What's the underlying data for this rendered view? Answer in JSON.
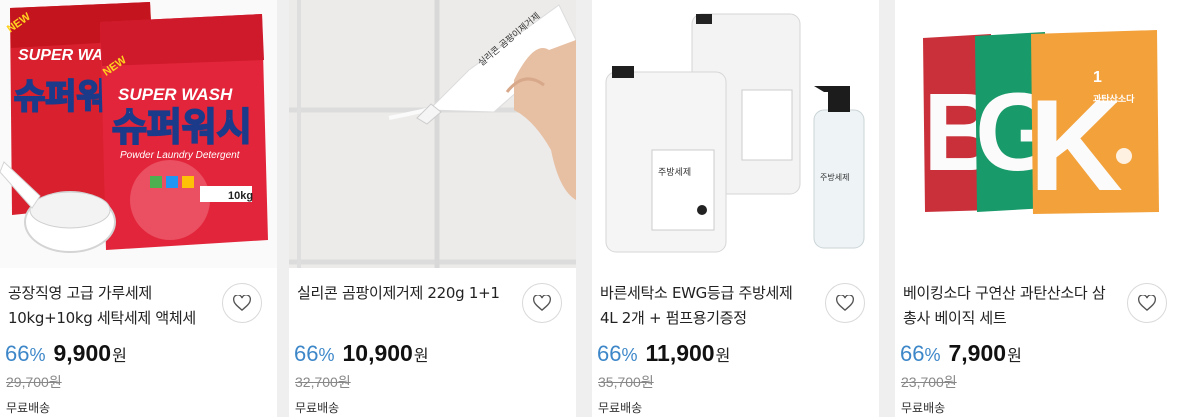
{
  "products": [
    {
      "title": "공장직영 고급 가루세제 10kg+10kg 세탁세제 액체세",
      "discount": "66",
      "price": "9,900",
      "currency": "원",
      "original_price": "29,700원",
      "shipping": "무료배송",
      "image_text": {
        "brand": "SUPER WASH",
        "name": "슈퍼워시",
        "sub": "Powder Laundry Detergent",
        "weight": "10kg",
        "badge": "NEW"
      }
    },
    {
      "title": "실리콘 곰팡이제거제 220g 1+1",
      "discount": "66",
      "price": "10,900",
      "currency": "원",
      "original_price": "32,700원",
      "shipping": "무료배송",
      "image_text": {
        "label": "실리콘 곰팡이제거제"
      }
    },
    {
      "title": "바른세탁소 EWG등급 주방세제 4L 2개 + 펌프용기증정",
      "discount": "66",
      "price": "11,900",
      "currency": "원",
      "original_price": "35,700원",
      "shipping": "무료배송",
      "image_text": {
        "label": "주방세제"
      }
    },
    {
      "title": "베이킹소다 구연산 과탄산소다 삼총사 베이직 세트",
      "discount": "66",
      "price": "7,900",
      "currency": "원",
      "original_price": "23,700원",
      "shipping": "무료배송",
      "image_text": {
        "letters": [
          "B",
          "G",
          "K"
        ],
        "number": "1",
        "label": "과탄산소다"
      }
    }
  ],
  "percent_sign": "%",
  "colors": {
    "discount": "#3d87c9",
    "background": "#efefef"
  },
  "icons": {
    "wish": "heart-icon"
  }
}
